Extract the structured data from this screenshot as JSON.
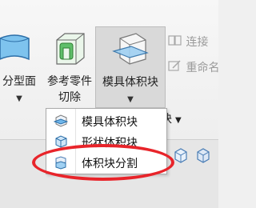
{
  "ribbon": {
    "tools": [
      {
        "id": "parting-surface",
        "label_lines": [
          "分型面"
        ],
        "arrow": "▼"
      },
      {
        "id": "ref-part-cutout",
        "label_lines": [
          "参考零件",
          "切除"
        ]
      },
      {
        "id": "mold-volume",
        "label_lines": [
          "模具体积块"
        ],
        "arrow": "▼",
        "selected": true
      }
    ],
    "right_cmds": [
      {
        "id": "connect",
        "label": "连接"
      },
      {
        "id": "rename",
        "label": "重命名"
      }
    ],
    "partial_text": "块",
    "partial_arrow": "▼"
  },
  "menu": {
    "items": [
      {
        "id": "mold-volume-item",
        "label": "模具体积块"
      },
      {
        "id": "shape-volume-item",
        "label": "形状体积块"
      },
      {
        "id": "volume-split-item",
        "label": "体积块分割"
      }
    ]
  },
  "colors": {
    "annotation": "#e8242a",
    "icon_blue": "#4a90d9",
    "icon_green": "#3aa14a",
    "selected_bg": "#d9d9d9"
  }
}
